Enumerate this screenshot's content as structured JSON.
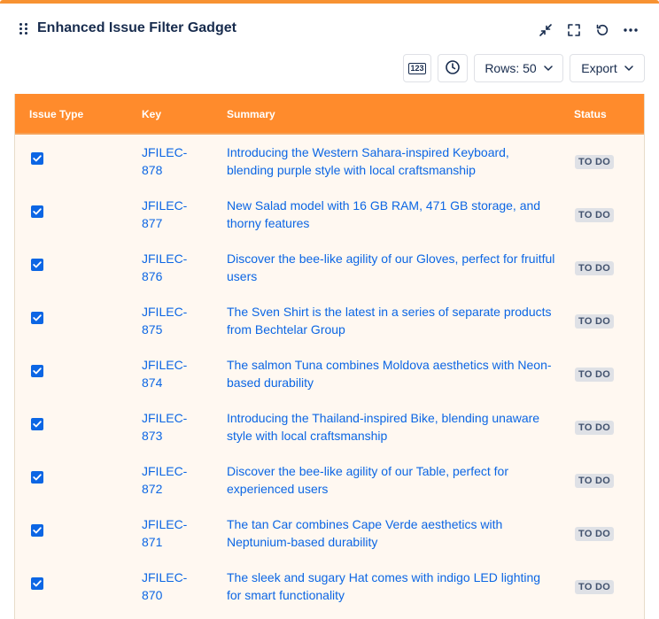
{
  "gadget": {
    "title": "Enhanced Issue Filter Gadget",
    "accent_color": "#f79232",
    "header_icons": [
      "collapse-icon",
      "expand-fullscreen-icon",
      "refresh-icon",
      "more-options-icon"
    ]
  },
  "toolbar": {
    "number_format_label": "123",
    "rows_label": "Rows: 50",
    "export_label": "Export"
  },
  "table": {
    "header_color": "#ff8b2c",
    "columns": [
      "Issue Type",
      "Key",
      "Summary",
      "Status"
    ],
    "rows": [
      {
        "checked": true,
        "key": "JFILEC-878",
        "summary": "Introducing the Western Sahara-inspired Keyboard, blending purple style with local craftsmanship",
        "status": "TO DO"
      },
      {
        "checked": true,
        "key": "JFILEC-877",
        "summary": "New Salad model with 16 GB RAM, 471 GB storage, and thorny features",
        "status": "TO DO"
      },
      {
        "checked": true,
        "key": "JFILEC-876",
        "summary": "Discover the bee-like agility of our Gloves, perfect for fruitful users",
        "status": "TO DO"
      },
      {
        "checked": true,
        "key": "JFILEC-875",
        "summary": "The Sven Shirt is the latest in a series of separate products from Bechtelar Group",
        "status": "TO DO"
      },
      {
        "checked": true,
        "key": "JFILEC-874",
        "summary": "The salmon Tuna combines Moldova aesthetics with Neon-based durability",
        "status": "TO DO"
      },
      {
        "checked": true,
        "key": "JFILEC-873",
        "summary": "Introducing the Thailand-inspired Bike, blending unaware style with local craftsmanship",
        "status": "TO DO"
      },
      {
        "checked": true,
        "key": "JFILEC-872",
        "summary": "Discover the bee-like agility of our Table, perfect for experienced users",
        "status": "TO DO"
      },
      {
        "checked": true,
        "key": "JFILEC-871",
        "summary": "The tan Car combines Cape Verde aesthetics with Neptunium-based durability",
        "status": "TO DO"
      },
      {
        "checked": true,
        "key": "JFILEC-870",
        "summary": "The sleek and sugary Hat comes with indigo LED lighting for smart functionality",
        "status": "TO DO"
      }
    ]
  }
}
